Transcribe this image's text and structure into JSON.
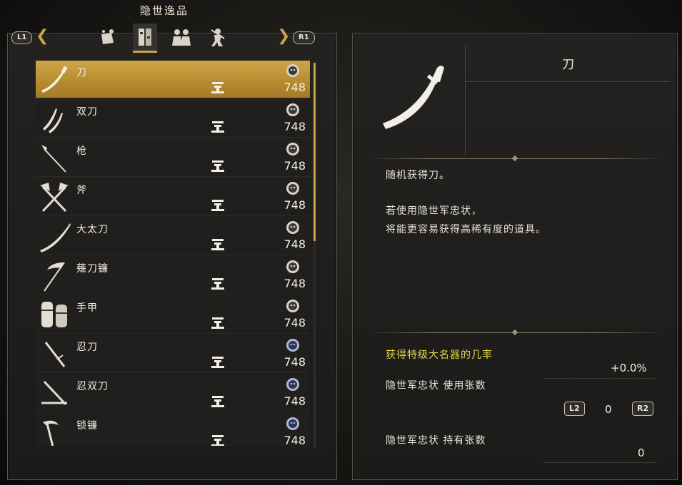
{
  "header": {
    "title": "隐世逸品",
    "left_shoulder": "L1",
    "right_shoulder": "R1"
  },
  "tabs": [
    {
      "icon": "item-bag-icon",
      "active": false
    },
    {
      "icon": "equipment-icon",
      "active": true
    },
    {
      "icon": "characters-icon",
      "active": false
    },
    {
      "icon": "ninja-icon",
      "active": false
    }
  ],
  "items": [
    {
      "name": "刀",
      "price": "748",
      "icon": "katana-icon",
      "badge": "oni-mask-icon"
    },
    {
      "name": "双刀",
      "price": "748",
      "icon": "dual-swords-icon",
      "badge": "oni-mask-icon"
    },
    {
      "name": "枪",
      "price": "748",
      "icon": "spear-icon",
      "badge": "oni-mask-icon"
    },
    {
      "name": "斧",
      "price": "748",
      "icon": "axe-icon",
      "badge": "oni-mask-icon"
    },
    {
      "name": "大太刀",
      "price": "748",
      "icon": "odachi-icon",
      "badge": "oni-mask-icon"
    },
    {
      "name": "薙刀镰",
      "price": "748",
      "icon": "switchglaive-icon",
      "badge": "oni-mask-icon"
    },
    {
      "name": "手甲",
      "price": "748",
      "icon": "fists-icon",
      "badge": "oni-mask-icon"
    },
    {
      "name": "忍刀",
      "price": "748",
      "icon": "ninja-sword-icon",
      "badge": "blue-mask-icon"
    },
    {
      "name": "忍双刀",
      "price": "748",
      "icon": "ninja-dual-swords-icon",
      "badge": "blue-mask-icon"
    },
    {
      "name": "锁镰",
      "price": "748",
      "icon": "kusarigama-icon",
      "badge": "blue-mask-icon"
    }
  ],
  "detail": {
    "name": "刀",
    "description_1": "随机获得刀。",
    "description_2": "若使用隐世军忠状，",
    "description_3": "将能更容易获得高稀有度的道具。",
    "chance_label": "获得特级大名器的几率",
    "chance_value": "+0.0%",
    "use_label": "隐世军忠状 使用张数",
    "use_value": "0",
    "hold_label": "隐世军忠状 持有张数",
    "hold_value": "0",
    "dec_button": "L2",
    "inc_button": "R2"
  },
  "colors": {
    "accent": "#c9a447",
    "highlight_text": "#e6d64a"
  }
}
